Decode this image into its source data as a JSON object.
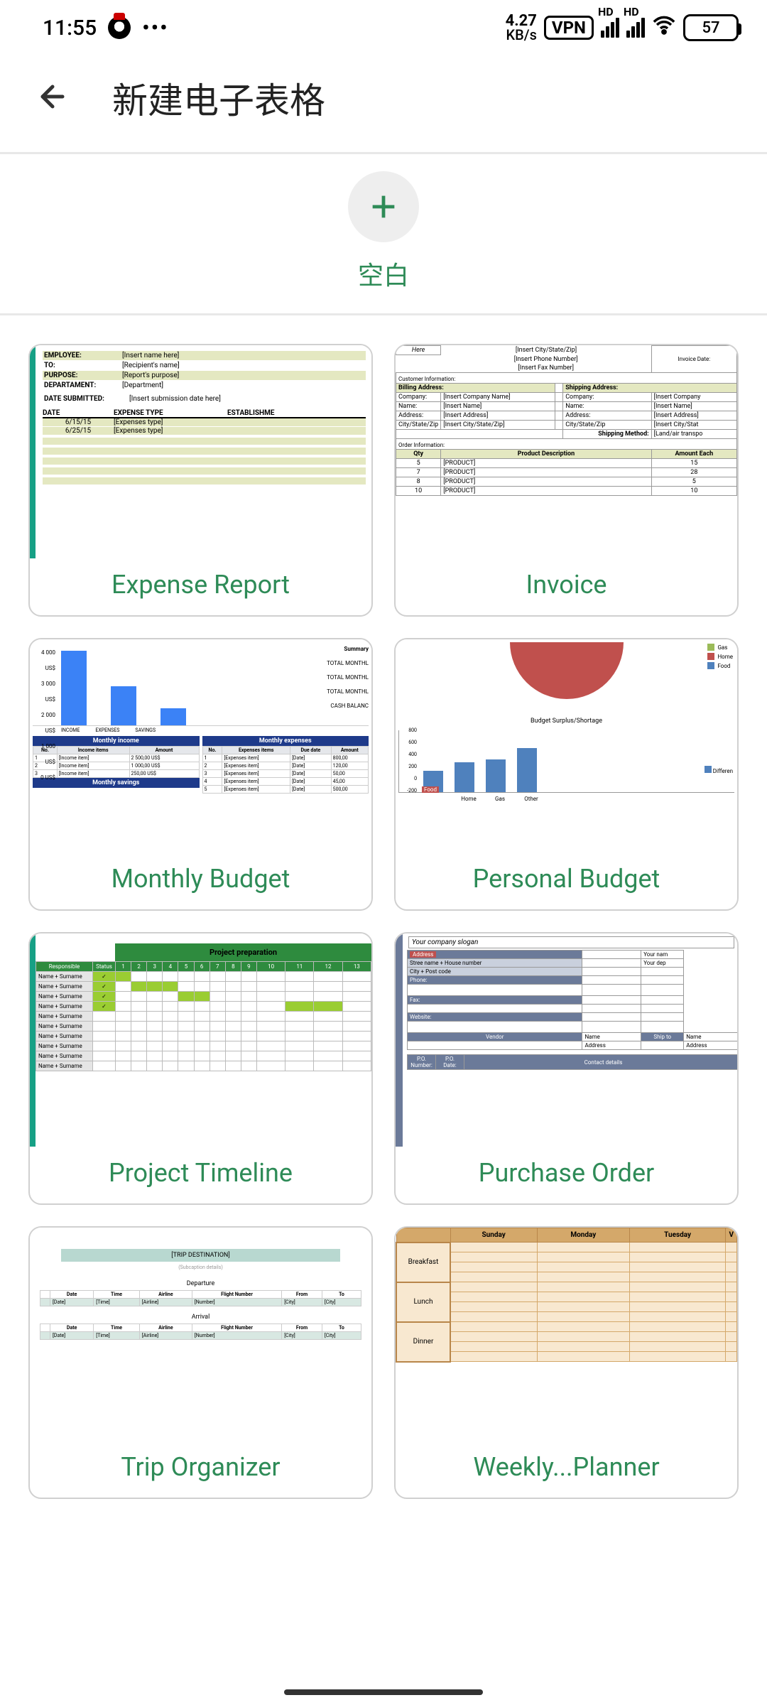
{
  "status": {
    "time": "11:55",
    "net_speed_value": "4.27",
    "net_speed_unit": "KB/s",
    "vpn": "VPN",
    "hd1": "HD",
    "hd2": "HD",
    "battery": "57"
  },
  "header": {
    "title": "新建电子表格"
  },
  "blank": {
    "label": "空白"
  },
  "templates": [
    {
      "label": "Expense Report"
    },
    {
      "label": "Invoice"
    },
    {
      "label": "Monthly Budget"
    },
    {
      "label": "Personal Budget"
    },
    {
      "label": "Project Timeline"
    },
    {
      "label": "Purchase Order"
    },
    {
      "label": "Trip Organizer"
    },
    {
      "label": "Weekly...Planner"
    }
  ],
  "exp": {
    "employee": "EMPLOYEE:",
    "employee_v": "[Insert name here]",
    "to": "TO:",
    "to_v": "[Recipient's name]",
    "purpose": "PURPOSE:",
    "purpose_v": "[Report's purpose]",
    "dept": "DEPARTAMENT:",
    "dept_v": "[Department]",
    "date_sub": "DATE SUBMITTED:",
    "date_sub_v": "[Insert submission date here]",
    "h_date": "DATE",
    "h_type": "EXPENSE TYPE",
    "h_est": "ESTABLISHME",
    "d1": "6/15/15",
    "d2": "6/25/15",
    "tv": "[Expenses type]"
  },
  "inv": {
    "here": "Here",
    "city": "[Insert City/State/Zip]",
    "phone": "[Insert Phone Number]",
    "fax": "[Insert Fax Number]",
    "inv_date": "Invoice Date:",
    "cust": "Customer Information:",
    "bill": "Billing Address:",
    "ship": "Shipping Address:",
    "company": "Company:",
    "company_v": "[Insert Company Name]",
    "company_v2": "[Insert Company",
    "name": "Name:",
    "name_v": "[Insert Name]",
    "addr": "Address:",
    "addr_v": "[Insert Address]",
    "csz": "City/State/Zip",
    "csz_v": "[Insert City/State/Zip]",
    "csz_v2": "[Insert City/Stat",
    "ship_method": "Shipping Method:",
    "ship_method_v": "[Land/air transpo",
    "order": "Order Information:",
    "qty": "Qty",
    "pdesc": "Product Description",
    "amt": "Amount Each",
    "prod": "[PRODUCT]",
    "q1": "5",
    "q2": "7",
    "q3": "8",
    "q4": "10",
    "a1": "15",
    "a2": "28",
    "a3": "5",
    "a4": "10"
  },
  "mbud": {
    "summary": "Summary",
    "y4": "4 000 US$",
    "y3": "3 000 US$",
    "y2": "2 000 US$",
    "y1": "1 000 US$",
    "y0": "0 US$",
    "x1": "INCOME",
    "x2": "EXPENSES",
    "x3": "SAVINGS",
    "tot1": "TOTAL MONTHL",
    "tot2": "TOTAL MONTHL",
    "tot3": "TOTAL MONTHL",
    "cash": "CASH BALANC",
    "t1": "Monthly income",
    "t2": "Monthly expenses",
    "t3": "Monthly savings",
    "th_no": "No.",
    "th_item": "Income items",
    "th_amt": "Amount",
    "th_eitem": "Expenses items",
    "th_due": "Due date",
    "r1": "[Income item]",
    "r1a": "2 500,00 US$",
    "r2a": "1 000,00 US$",
    "r3a": "250,00 US$",
    "e1": "[Expenses item]",
    "e1d": "[Date]",
    "e1a": "800,00",
    "e2a": "120,00",
    "e3a": "50,00",
    "e4a": "45,00",
    "e5a": "500,00"
  },
  "pbud": {
    "leg_gas": "Gas",
    "leg_home": "Home",
    "leg_food": "Food",
    "caption": "Budget Surplus/Shortage",
    "y800": "800",
    "y600": "600",
    "y400": "400",
    "y200": "200",
    "y0": "0",
    "yn200": "-200",
    "x_food": "Food",
    "x_home": "Home",
    "x_gas": "Gas",
    "x_other": "Other",
    "diff": "Differen"
  },
  "ptl": {
    "title": "Project preparation",
    "resp": "Responsible",
    "status": "Status",
    "name": "Name + Surname",
    "nums": [
      "1",
      "2",
      "3",
      "4",
      "5",
      "6",
      "7",
      "8",
      "9",
      "10",
      "11",
      "12",
      "13"
    ]
  },
  "porder": {
    "slogan": "Your company slogan",
    "address": "Address",
    "yourname": "Your nam",
    "yourdep": "Your dep",
    "street": "Stree name + House number",
    "citypost": "City + Post code",
    "phone": "Phone:",
    "fax": "Fax:",
    "website": "Website:",
    "vendor": "Vendor",
    "shipto": "Ship to",
    "name": "Name",
    "addr": "Address",
    "po": "P.O.",
    "number": "Number:",
    "date": "P.O.",
    "date2": "Date:",
    "contact": "Contact details"
  },
  "trip": {
    "dest": "[TRIP DESTINATION]",
    "sub": "(Subcaption details)",
    "departure": "Departure",
    "arrival": "Arrival",
    "h_date": "Date",
    "h_time": "Time",
    "h_airline": "Airline",
    "h_flight": "Flight Number",
    "h_from": "From",
    "h_to": "To",
    "v_date": "[Date]",
    "v_time": "[Time]",
    "v_airline": "[Airline]",
    "v_num": "[Number]",
    "v_city": "[City]"
  },
  "wplan": {
    "sun": "Sunday",
    "mon": "Monday",
    "tue": "Tuesday",
    "w": "V",
    "bf": "Breakfast",
    "lunch": "Lunch",
    "dinner": "Dinner"
  }
}
